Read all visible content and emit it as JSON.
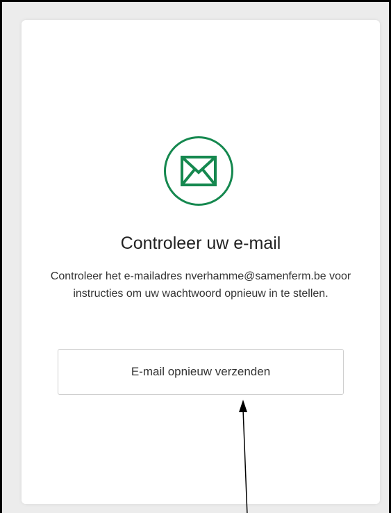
{
  "card": {
    "title": "Controleer uw e-mail",
    "message": "Controleer het e-mailadres nverhamme@samenferm.be voor instructies om uw wachtwoord opnieuw in te stellen.",
    "icon": "envelope-icon",
    "resend_label": "E-mail opnieuw verzenden"
  },
  "colors": {
    "accent": "#15884f",
    "background": "#ececec",
    "card": "#ffffff"
  }
}
